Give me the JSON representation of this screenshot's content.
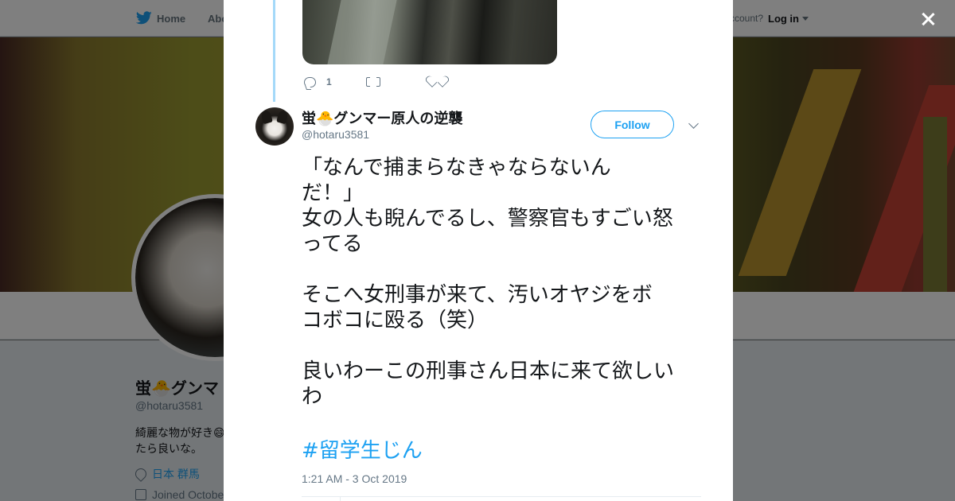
{
  "nav": {
    "home_label": "Home",
    "about_label": "Abo",
    "account_prompt": "ccount?",
    "login_label": "Log in"
  },
  "background_profile": {
    "name": "蛍🐣グンマ",
    "handle": "@hotaru3581",
    "bio_line1": "綺麗な物が好き😄",
    "bio_line2": "たら良いな。",
    "location": "日本 群馬",
    "joined": "Joined Octobe"
  },
  "thread": {
    "reply_count": "1",
    "retweet_count": "",
    "like_count": ""
  },
  "tweet": {
    "author_name": "蛍🐣グンマー原人の逆襲",
    "author_handle": "@hotaru3581",
    "follow_label": "Follow",
    "lines": [
      "「なんで捕まらなきゃならないん",
      "だ！」",
      "女の人も睨んでるし、警察官もすごい怒",
      "ってる",
      "",
      "そこへ女刑事が来て、汚いオヤジをボ",
      "コボコに殴る（笑）",
      "",
      "良いわーこの刑事さん日本に来て欲しい",
      "わ"
    ],
    "hashtag": "#留学生じん",
    "timestamp": "1:21 AM - 3 Oct 2019"
  },
  "colors": {
    "accent": "#1da1f2",
    "thread_line": "#a4d9f9",
    "muted": "#657786",
    "text": "#14171a"
  },
  "icons": {
    "close": "close-icon",
    "reply": "reply-icon",
    "retweet": "retweet-icon",
    "like": "heart-icon",
    "more": "chevron-down-icon",
    "brand": "twitter-bird-icon"
  }
}
